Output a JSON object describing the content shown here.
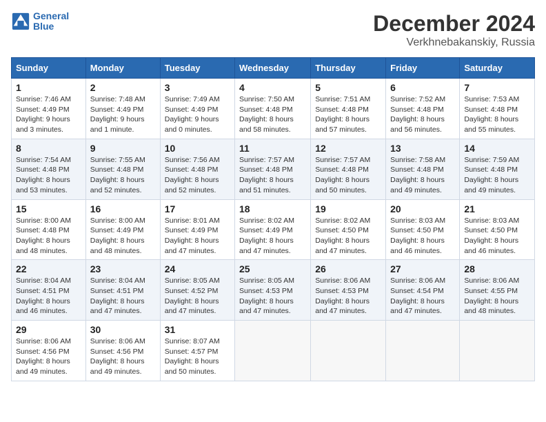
{
  "header": {
    "logo_line1": "General",
    "logo_line2": "Blue",
    "title": "December 2024",
    "subtitle": "Verkhnebakanskiy, Russia"
  },
  "columns": [
    "Sunday",
    "Monday",
    "Tuesday",
    "Wednesday",
    "Thursday",
    "Friday",
    "Saturday"
  ],
  "weeks": [
    [
      {
        "day": "1",
        "sunrise": "Sunrise: 7:46 AM",
        "sunset": "Sunset: 4:49 PM",
        "daylight": "Daylight: 9 hours and 3 minutes."
      },
      {
        "day": "2",
        "sunrise": "Sunrise: 7:48 AM",
        "sunset": "Sunset: 4:49 PM",
        "daylight": "Daylight: 9 hours and 1 minute."
      },
      {
        "day": "3",
        "sunrise": "Sunrise: 7:49 AM",
        "sunset": "Sunset: 4:49 PM",
        "daylight": "Daylight: 9 hours and 0 minutes."
      },
      {
        "day": "4",
        "sunrise": "Sunrise: 7:50 AM",
        "sunset": "Sunset: 4:48 PM",
        "daylight": "Daylight: 8 hours and 58 minutes."
      },
      {
        "day": "5",
        "sunrise": "Sunrise: 7:51 AM",
        "sunset": "Sunset: 4:48 PM",
        "daylight": "Daylight: 8 hours and 57 minutes."
      },
      {
        "day": "6",
        "sunrise": "Sunrise: 7:52 AM",
        "sunset": "Sunset: 4:48 PM",
        "daylight": "Daylight: 8 hours and 56 minutes."
      },
      {
        "day": "7",
        "sunrise": "Sunrise: 7:53 AM",
        "sunset": "Sunset: 4:48 PM",
        "daylight": "Daylight: 8 hours and 55 minutes."
      }
    ],
    [
      {
        "day": "8",
        "sunrise": "Sunrise: 7:54 AM",
        "sunset": "Sunset: 4:48 PM",
        "daylight": "Daylight: 8 hours and 53 minutes."
      },
      {
        "day": "9",
        "sunrise": "Sunrise: 7:55 AM",
        "sunset": "Sunset: 4:48 PM",
        "daylight": "Daylight: 8 hours and 52 minutes."
      },
      {
        "day": "10",
        "sunrise": "Sunrise: 7:56 AM",
        "sunset": "Sunset: 4:48 PM",
        "daylight": "Daylight: 8 hours and 52 minutes."
      },
      {
        "day": "11",
        "sunrise": "Sunrise: 7:57 AM",
        "sunset": "Sunset: 4:48 PM",
        "daylight": "Daylight: 8 hours and 51 minutes."
      },
      {
        "day": "12",
        "sunrise": "Sunrise: 7:57 AM",
        "sunset": "Sunset: 4:48 PM",
        "daylight": "Daylight: 8 hours and 50 minutes."
      },
      {
        "day": "13",
        "sunrise": "Sunrise: 7:58 AM",
        "sunset": "Sunset: 4:48 PM",
        "daylight": "Daylight: 8 hours and 49 minutes."
      },
      {
        "day": "14",
        "sunrise": "Sunrise: 7:59 AM",
        "sunset": "Sunset: 4:48 PM",
        "daylight": "Daylight: 8 hours and 49 minutes."
      }
    ],
    [
      {
        "day": "15",
        "sunrise": "Sunrise: 8:00 AM",
        "sunset": "Sunset: 4:48 PM",
        "daylight": "Daylight: 8 hours and 48 minutes."
      },
      {
        "day": "16",
        "sunrise": "Sunrise: 8:00 AM",
        "sunset": "Sunset: 4:49 PM",
        "daylight": "Daylight: 8 hours and 48 minutes."
      },
      {
        "day": "17",
        "sunrise": "Sunrise: 8:01 AM",
        "sunset": "Sunset: 4:49 PM",
        "daylight": "Daylight: 8 hours and 47 minutes."
      },
      {
        "day": "18",
        "sunrise": "Sunrise: 8:02 AM",
        "sunset": "Sunset: 4:49 PM",
        "daylight": "Daylight: 8 hours and 47 minutes."
      },
      {
        "day": "19",
        "sunrise": "Sunrise: 8:02 AM",
        "sunset": "Sunset: 4:50 PM",
        "daylight": "Daylight: 8 hours and 47 minutes."
      },
      {
        "day": "20",
        "sunrise": "Sunrise: 8:03 AM",
        "sunset": "Sunset: 4:50 PM",
        "daylight": "Daylight: 8 hours and 46 minutes."
      },
      {
        "day": "21",
        "sunrise": "Sunrise: 8:03 AM",
        "sunset": "Sunset: 4:50 PM",
        "daylight": "Daylight: 8 hours and 46 minutes."
      }
    ],
    [
      {
        "day": "22",
        "sunrise": "Sunrise: 8:04 AM",
        "sunset": "Sunset: 4:51 PM",
        "daylight": "Daylight: 8 hours and 46 minutes."
      },
      {
        "day": "23",
        "sunrise": "Sunrise: 8:04 AM",
        "sunset": "Sunset: 4:51 PM",
        "daylight": "Daylight: 8 hours and 47 minutes."
      },
      {
        "day": "24",
        "sunrise": "Sunrise: 8:05 AM",
        "sunset": "Sunset: 4:52 PM",
        "daylight": "Daylight: 8 hours and 47 minutes."
      },
      {
        "day": "25",
        "sunrise": "Sunrise: 8:05 AM",
        "sunset": "Sunset: 4:53 PM",
        "daylight": "Daylight: 8 hours and 47 minutes."
      },
      {
        "day": "26",
        "sunrise": "Sunrise: 8:06 AM",
        "sunset": "Sunset: 4:53 PM",
        "daylight": "Daylight: 8 hours and 47 minutes."
      },
      {
        "day": "27",
        "sunrise": "Sunrise: 8:06 AM",
        "sunset": "Sunset: 4:54 PM",
        "daylight": "Daylight: 8 hours and 47 minutes."
      },
      {
        "day": "28",
        "sunrise": "Sunrise: 8:06 AM",
        "sunset": "Sunset: 4:55 PM",
        "daylight": "Daylight: 8 hours and 48 minutes."
      }
    ],
    [
      {
        "day": "29",
        "sunrise": "Sunrise: 8:06 AM",
        "sunset": "Sunset: 4:56 PM",
        "daylight": "Daylight: 8 hours and 49 minutes."
      },
      {
        "day": "30",
        "sunrise": "Sunrise: 8:06 AM",
        "sunset": "Sunset: 4:56 PM",
        "daylight": "Daylight: 8 hours and 49 minutes."
      },
      {
        "day": "31",
        "sunrise": "Sunrise: 8:07 AM",
        "sunset": "Sunset: 4:57 PM",
        "daylight": "Daylight: 8 hours and 50 minutes."
      },
      null,
      null,
      null,
      null
    ]
  ]
}
